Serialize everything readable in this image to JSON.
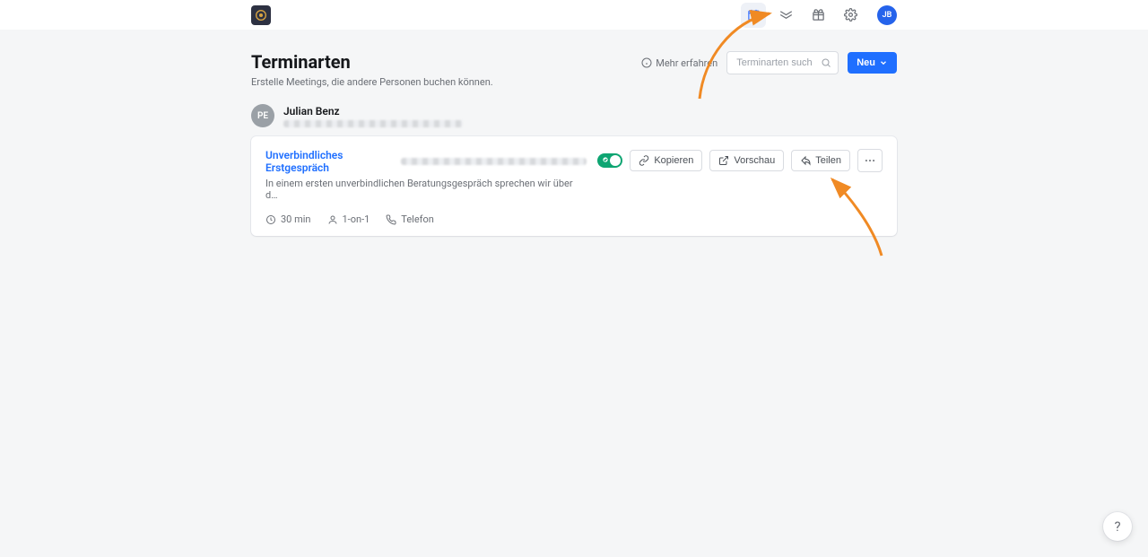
{
  "topbar": {
    "avatar_initials": "JB"
  },
  "page": {
    "title": "Terminarten",
    "subtitle": "Erstelle Meetings, die andere Personen buchen können.",
    "learn_more": "Mehr erfahren",
    "search_placeholder": "Terminarten suchen",
    "new_button": "Neu"
  },
  "owner": {
    "avatar_initials": "PE",
    "name": "Julian Benz"
  },
  "card": {
    "title": "Unverbindliches Erstgespräch",
    "description": "In einem ersten unverbindlichen Beratungsgespräch sprechen wir über d…",
    "toggle_on": true,
    "actions": {
      "copy": "Kopieren",
      "preview": "Vorschau",
      "share": "Teilen"
    },
    "meta": {
      "duration": "30 min",
      "attendees": "1-on-1",
      "location": "Telefon"
    }
  },
  "help": {
    "label": "?"
  }
}
